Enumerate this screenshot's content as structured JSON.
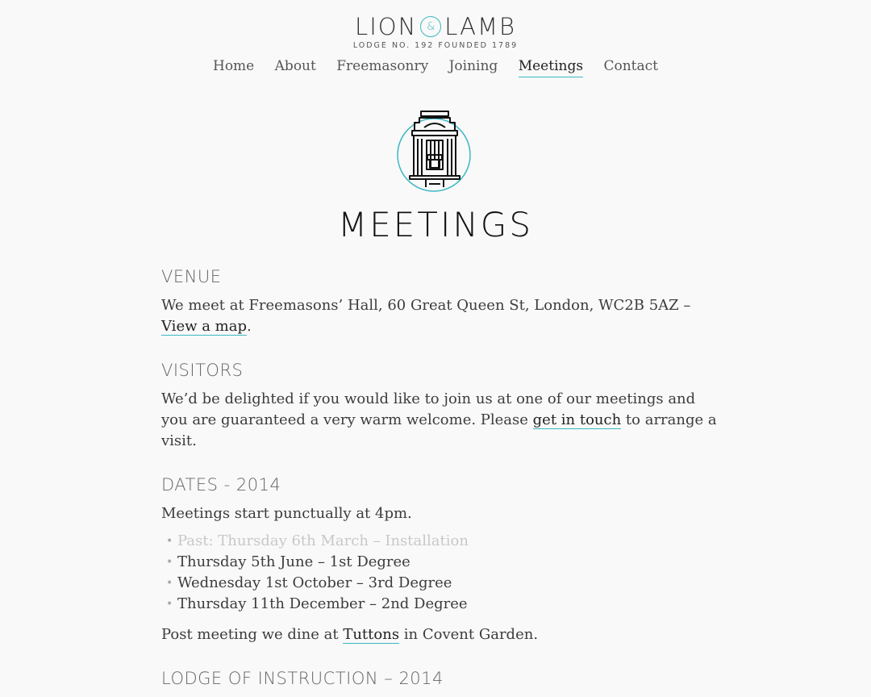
{
  "logo": {
    "left_word": "LION",
    "ampersand": "&",
    "right_word": "LAMB",
    "tagline": "LODGE NO. 192 FOUNDED 1789"
  },
  "nav": {
    "items": [
      "Home",
      "About",
      "Freemasonry",
      "Joining",
      "Meetings",
      "Contact"
    ],
    "active": "Meetings"
  },
  "page": {
    "title": "MEETINGS",
    "icon": "freemasons-hall-icon"
  },
  "venue": {
    "heading": "VENUE",
    "text": "We meet at Freemasons’ Hall, 60 Great Queen St, London, WC2B 5AZ – ",
    "link": "View a map",
    "suffix": "."
  },
  "visitors": {
    "heading": "VISITORS",
    "text": "We’d be delighted if you would like to join us at one of our meetings and you are guaranteed a very warm welcome. Please ",
    "link": "get in touch",
    "suffix": " to arrange a visit."
  },
  "dates": {
    "heading": "DATES - 2014",
    "intro": "Meetings start punctually at 4pm.",
    "items": [
      {
        "text": "Past: Thursday 6th March – Installation",
        "past": true
      },
      {
        "text": "Thursday 5th June – 1st Degree",
        "past": false
      },
      {
        "text": "Wednesday 1st October – 3rd Degree",
        "past": false
      },
      {
        "text": "Thursday 11th December – 2nd Degree",
        "past": false
      }
    ],
    "dine_prefix": "Post meeting we dine at ",
    "dine_link": "Tuttons",
    "dine_suffix": " in Covent Garden."
  },
  "instruction": {
    "heading": "LODGE OF INSTRUCTION – 2014"
  },
  "colors": {
    "accent": "#3bb8c3",
    "background": "#f9f9f9",
    "past_text": "#c8c8c8"
  }
}
